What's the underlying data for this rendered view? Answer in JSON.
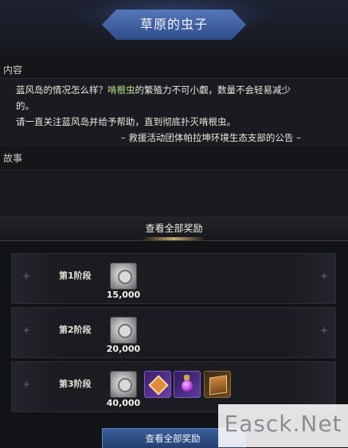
{
  "header": {
    "title": "草原的虫子"
  },
  "content_section": {
    "label": "内容",
    "line1_a": "蓝风岛的情况怎么样？",
    "line1_hl": "啃根虫",
    "line1_b": "的繁殖力不可小觑，数量不会轻易减少",
    "line2": "的。",
    "line3": "请一直关注蓝风岛并给予帮助，直到彻底扑灭啃根虫。",
    "signature": "– 救援活动团体帕拉坤环境生态支部的公告 –"
  },
  "story_section": {
    "label": "故事"
  },
  "rewards": {
    "title": "查看全部奖励",
    "stages": [
      {
        "label": "第1阶段",
        "amount": "15,000"
      },
      {
        "label": "第2阶段",
        "amount": "20,000"
      },
      {
        "label": "第3阶段",
        "amount": "40,000"
      }
    ],
    "stage3_items": [
      "emblem-icon",
      "purple-vial-icon",
      "book-icon"
    ]
  },
  "bottom_button": {
    "label": "查看全部奖励"
  },
  "watermark": {
    "text": "Easck.Net"
  },
  "colors": {
    "title_plate": "#3f5f9e",
    "highlight": "#b9e08a",
    "button": "#2f4f86"
  }
}
